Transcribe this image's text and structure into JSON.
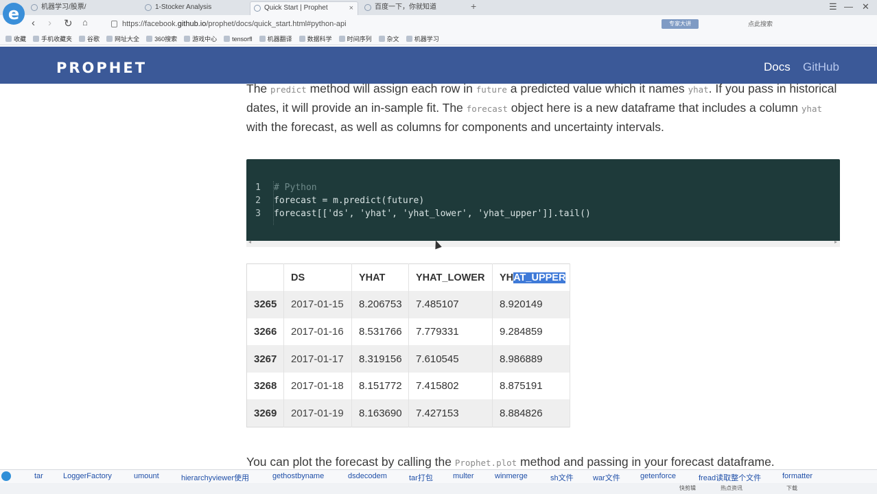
{
  "browser": {
    "logo_glyph": "e",
    "tabs": [
      {
        "label": "机器学习/股票/"
      },
      {
        "label": "1-Stocker Analysis"
      },
      {
        "label": "Quick Start | Prophet"
      },
      {
        "label": "百度一下，你就知道"
      }
    ],
    "new_tab": "+",
    "url_prefix": "https://facebook.",
    "url_domain": "github.io",
    "url_path": "/prophet/docs/quick_start.html#python-api",
    "ext_badge": "专家大讲",
    "search_placeholder": "点此搜索",
    "bookmarks": [
      "收藏",
      "手机收藏夹",
      "谷歌",
      "网址大全",
      "360搜索",
      "游戏中心",
      "tensorfl",
      "机器翻译",
      "数据科学",
      "时间序列",
      "杂文",
      "机器学习"
    ]
  },
  "site": {
    "logo": "PROPHET",
    "nav_docs": "Docs",
    "nav_github": "GitHub"
  },
  "article": {
    "p1_a": "The ",
    "p1_code1": "predict",
    "p1_b": " method will assign each row in ",
    "p1_code2": "future",
    "p1_c": " a predicted value which it names ",
    "p1_code3": "yhat",
    "p1_d": ". If you pass in historical dates, it will provide an in-sample fit. The ",
    "p1_code4": "forecast",
    "p1_e": " object here is a new dataframe that includes a column ",
    "p1_code5": "yhat",
    "p1_f": " with the forecast, as well as columns for components and uncertainty intervals.",
    "code_lines": [
      {
        "n": "1",
        "text": "# Python"
      },
      {
        "n": "2",
        "text": "forecast = m.predict(future)"
      },
      {
        "n": "3",
        "text": "forecast[['ds', 'yhat', 'yhat_lower', 'yhat_upper']].tail()"
      }
    ],
    "table": {
      "headers": [
        "",
        "DS",
        "YHAT",
        "YHAT_LOWER",
        "YH",
        "AT_UPPER"
      ],
      "rows": [
        [
          "3265",
          "2017-01-15",
          "8.206753",
          "7.485107",
          "8.920149"
        ],
        [
          "3266",
          "2017-01-16",
          "8.531766",
          "7.779331",
          "9.284859"
        ],
        [
          "3267",
          "2017-01-17",
          "8.319156",
          "7.610545",
          "8.986889"
        ],
        [
          "3268",
          "2017-01-18",
          "8.151772",
          "7.415802",
          "8.875191"
        ],
        [
          "3269",
          "2017-01-19",
          "8.163690",
          "7.427153",
          "8.884826"
        ]
      ]
    },
    "p2_a": "You can plot the forecast by calling the ",
    "p2_code": "Prophet.plot",
    "p2_b": " method and passing in your forecast dataframe."
  },
  "suggestions": [
    "tar",
    "LoggerFactory",
    "umount",
    "hierarchyviewer使用",
    "gethostbyname",
    "dsdecodem",
    "tar打包",
    "multer",
    "winmerge",
    "sh文件",
    "war文件",
    "getenforce",
    "fread读取整个文件",
    "formatter"
  ],
  "status": [
    "快剪辑",
    "热点资讯",
    "下载"
  ]
}
